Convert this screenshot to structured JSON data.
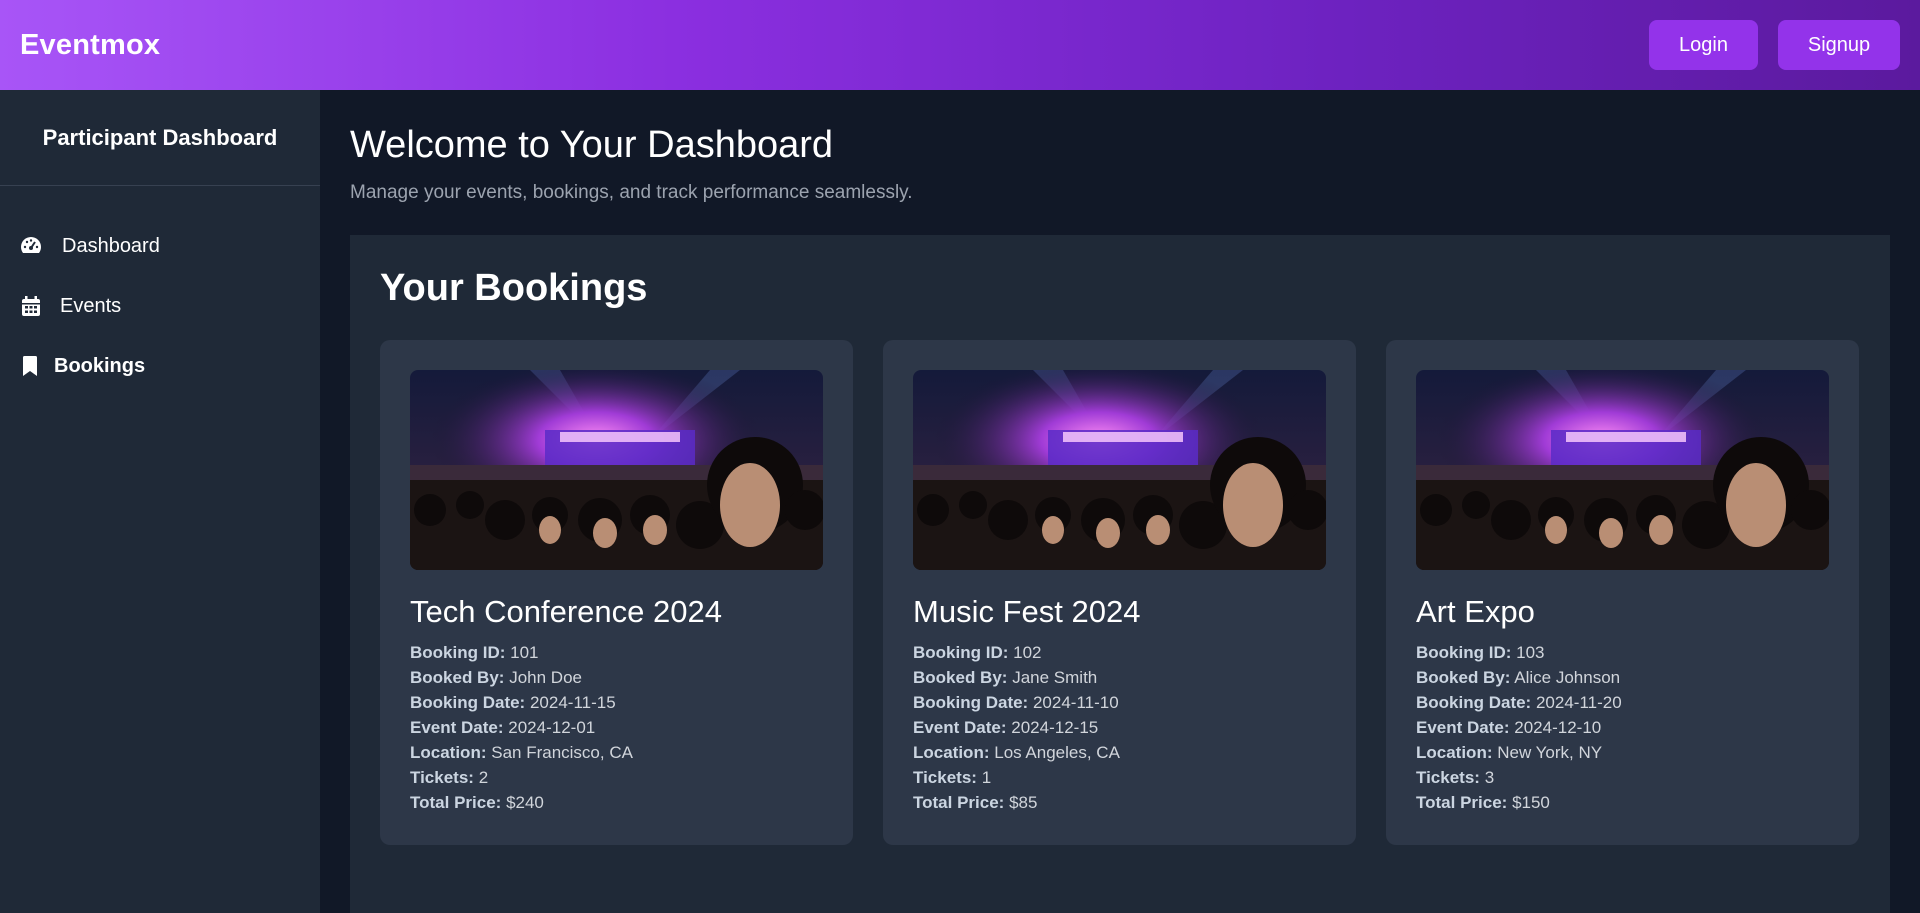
{
  "header": {
    "brand": "Eventmox",
    "login_label": "Login",
    "signup_label": "Signup"
  },
  "sidebar": {
    "title": "Participant Dashboard",
    "items": [
      {
        "label": "Dashboard",
        "icon": "gauge-icon"
      },
      {
        "label": "Events",
        "icon": "calendar-icon"
      },
      {
        "label": "Bookings",
        "icon": "bookmark-icon",
        "active": true
      }
    ]
  },
  "main": {
    "title": "Welcome to Your Dashboard",
    "subtitle": "Manage your events, bookings, and track performance seamlessly.",
    "section_title": "Your Bookings"
  },
  "labels": {
    "booking_id": "Booking ID:",
    "booked_by": "Booked By:",
    "booking_date": "Booking Date:",
    "event_date": "Event Date:",
    "location": "Location:",
    "tickets": "Tickets:",
    "total_price": "Total Price:"
  },
  "bookings": [
    {
      "title": "Tech Conference 2024",
      "booking_id": "101",
      "booked_by": "John Doe",
      "booking_date": "2024-11-15",
      "event_date": "2024-12-01",
      "location": "San Francisco, CA",
      "tickets": "2",
      "total_price": "$240"
    },
    {
      "title": "Music Fest 2024",
      "booking_id": "102",
      "booked_by": "Jane Smith",
      "booking_date": "2024-11-10",
      "event_date": "2024-12-15",
      "location": "Los Angeles, CA",
      "tickets": "1",
      "total_price": "$85"
    },
    {
      "title": "Art Expo",
      "booking_id": "103",
      "booked_by": "Alice Johnson",
      "booking_date": "2024-11-20",
      "event_date": "2024-12-10",
      "location": "New York, NY",
      "tickets": "3",
      "total_price": "$150"
    }
  ],
  "colors": {
    "accent": "#9333ea",
    "background": "#111827",
    "sidebar": "#1f2937",
    "card": "#2d3748"
  }
}
